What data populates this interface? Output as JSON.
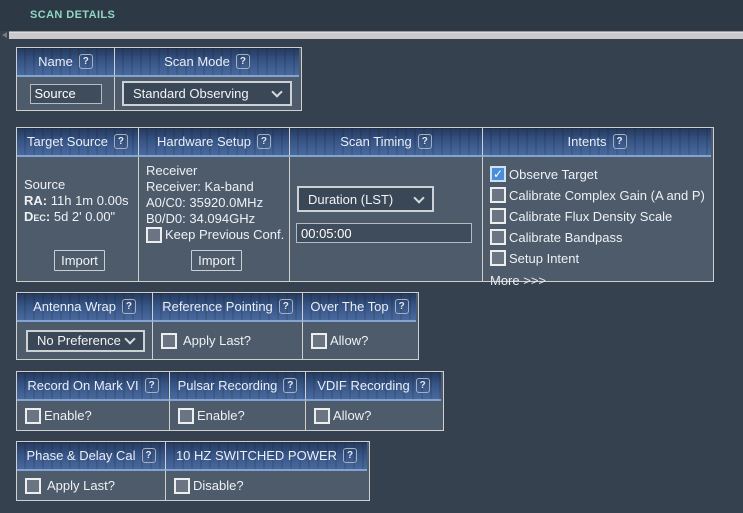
{
  "icons": {
    "help": "?"
  },
  "header": {
    "title": "SCAN DETAILS"
  },
  "name_mode_table": {
    "name_header": "Name",
    "scan_mode_header": "Scan Mode",
    "name_value": "Source",
    "scan_mode_value": "Standard Observing"
  },
  "main_table": {
    "headers": {
      "target_source": "Target Source",
      "hardware_setup": "Hardware Setup",
      "scan_timing": "Scan Timing",
      "intents": "Intents"
    },
    "target_source": {
      "source_name": "Source",
      "ra_label": "RA:",
      "ra_value": "11h 1m 0.00s",
      "dec_label": "Dec:",
      "dec_value": "5d 2' 0.00\"",
      "import_button": "Import"
    },
    "hardware_setup": {
      "title": "Receiver",
      "receiver_line": "Receiver: Ka-band",
      "a0c0_line": "A0/C0: 35920.0MHz",
      "b0d0_line": "B0/D0: 34.094GHz",
      "keep_previous": {
        "label": "Keep Previous Conf.",
        "checked": false
      },
      "import_button": "Import"
    },
    "scan_timing": {
      "mode_selected": "Duration (LST)",
      "duration_value": "00:05:00"
    },
    "intents": {
      "items": [
        {
          "label": "Observe Target",
          "checked": true
        },
        {
          "label": "Calibrate Complex Gain (A and P)",
          "checked": false
        },
        {
          "label": "Calibrate Flux Density Scale",
          "checked": false
        },
        {
          "label": "Calibrate Bandpass",
          "checked": false
        },
        {
          "label": "Setup Intent",
          "checked": false
        }
      ],
      "more_link": "More >>>"
    }
  },
  "wrap_table": {
    "headers": {
      "antenna_wrap": "Antenna Wrap",
      "reference_pointing": "Reference Pointing",
      "over_the_top": "Over The Top"
    },
    "antenna_wrap_selected": "No Preference",
    "reference_pointing": {
      "label": "Apply Last?",
      "checked": false
    },
    "over_the_top": {
      "label": "Allow?",
      "checked": false
    }
  },
  "recording_table": {
    "headers": {
      "mark_vi": "Record On Mark VI",
      "pulsar": "Pulsar Recording",
      "vdif": "VDIF Recording"
    },
    "mark_vi": {
      "label": "Enable?",
      "checked": false
    },
    "pulsar": {
      "label": "Enable?",
      "checked": false
    },
    "vdif": {
      "label": "Allow?",
      "checked": false
    }
  },
  "cal_table": {
    "headers": {
      "phase_delay": "Phase & Delay Cal",
      "switched_power": "10 HZ SWITCHED POWER"
    },
    "phase_delay": {
      "label": "Apply Last?",
      "checked": false
    },
    "switched_power": {
      "label": "Disable?",
      "checked": false
    }
  }
}
